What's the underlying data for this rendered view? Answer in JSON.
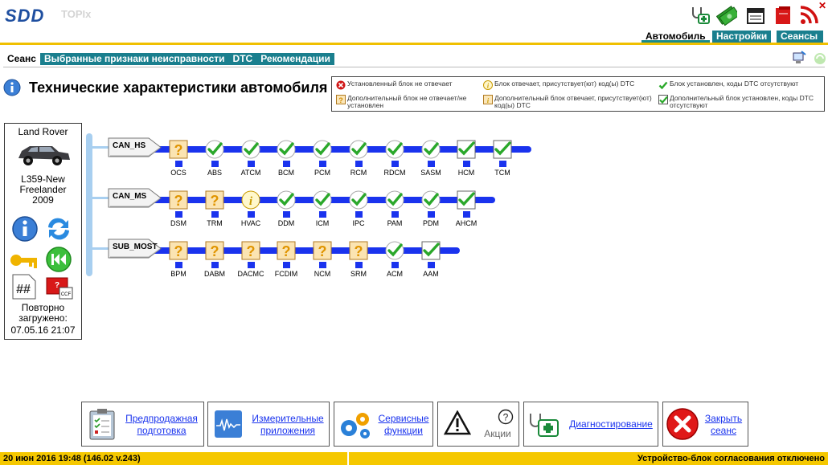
{
  "app": {
    "logo": "SDD",
    "product": "TOPIx"
  },
  "top_tabs": [
    {
      "label": "Автомобиль",
      "active": true
    },
    {
      "label": "Настройки",
      "active": false
    },
    {
      "label": "Сеансы",
      "active": false
    }
  ],
  "sub_tabs": [
    {
      "label": "Сеанс",
      "active": true
    },
    {
      "label": "Выбранные признаки неисправности",
      "active": false
    },
    {
      "label": "DTC",
      "active": false
    },
    {
      "label": "Рекомендации",
      "active": false
    }
  ],
  "page_title": "Технические характеристики автомобиля",
  "legend": [
    {
      "icon": "red-x",
      "text": "Установленный блок не отвечает"
    },
    {
      "icon": "info",
      "text": "Блок отвечает, присутствует(ют) код(ы) DTC"
    },
    {
      "icon": "check",
      "text": "Блок установлен, коды DTC отсутствуют"
    },
    {
      "icon": "question",
      "text": "Дополнительный блок не отвечает/не установлен"
    },
    {
      "icon": "info-box",
      "text": "Дополнительный блок отвечает, присутствует(ют) код(ы) DTC"
    },
    {
      "icon": "check-box",
      "text": "Дополнительный блок установлен, коды DTC отсутствуют"
    }
  ],
  "vehicle": {
    "make": "Land Rover",
    "model": "L359-New Freelander 2009",
    "reload_label": "Повторно загружено:",
    "reload_time": "07.05.16 21:07"
  },
  "buses": [
    {
      "name": "CAN_HS",
      "modules": [
        {
          "name": "OCS",
          "status": "question"
        },
        {
          "name": "ABS",
          "status": "check"
        },
        {
          "name": "ATCM",
          "status": "check"
        },
        {
          "name": "BCM",
          "status": "check"
        },
        {
          "name": "PCM",
          "status": "check"
        },
        {
          "name": "RCM",
          "status": "check"
        },
        {
          "name": "RDCM",
          "status": "check"
        },
        {
          "name": "SASM",
          "status": "check"
        },
        {
          "name": "HCM",
          "status": "check-box"
        },
        {
          "name": "TCM",
          "status": "check-box"
        }
      ]
    },
    {
      "name": "CAN_MS",
      "modules": [
        {
          "name": "DSM",
          "status": "question"
        },
        {
          "name": "TRM",
          "status": "question"
        },
        {
          "name": "HVAC",
          "status": "info"
        },
        {
          "name": "DDM",
          "status": "check"
        },
        {
          "name": "ICM",
          "status": "check"
        },
        {
          "name": "IPC",
          "status": "check"
        },
        {
          "name": "PAM",
          "status": "check"
        },
        {
          "name": "PDM",
          "status": "check"
        },
        {
          "name": "AHCM",
          "status": "check-box"
        }
      ]
    },
    {
      "name": "SUB_MOST",
      "modules": [
        {
          "name": "BPM",
          "status": "question"
        },
        {
          "name": "DABM",
          "status": "question"
        },
        {
          "name": "DACMC",
          "status": "question"
        },
        {
          "name": "FCDIM",
          "status": "question"
        },
        {
          "name": "NCM",
          "status": "question"
        },
        {
          "name": "SRM",
          "status": "question"
        },
        {
          "name": "ACM",
          "status": "check"
        },
        {
          "name": "AAM",
          "status": "check-box"
        }
      ]
    }
  ],
  "bottom_buttons": [
    {
      "label": "Предпродажная подготовка",
      "icon": "clipboard-icon"
    },
    {
      "label": "Измерительные приложения",
      "icon": "waveform-icon"
    },
    {
      "label": "Сервисные функции",
      "icon": "gears-icon"
    },
    {
      "label": "Акции",
      "icon": "warning-icon"
    },
    {
      "label": "Диагностирование",
      "icon": "medkit-icon"
    },
    {
      "label": "Закрыть сеанс",
      "icon": "close-session-icon"
    }
  ],
  "status": {
    "left": "20 июн 2016 19:48 (146.02 v.243)",
    "right": "Устройство-блок согласования отключено"
  },
  "colors": {
    "bus": "#1a33ee",
    "tab": "#1a7f8e",
    "status": "#f5c800",
    "link": "#1a33ee"
  }
}
